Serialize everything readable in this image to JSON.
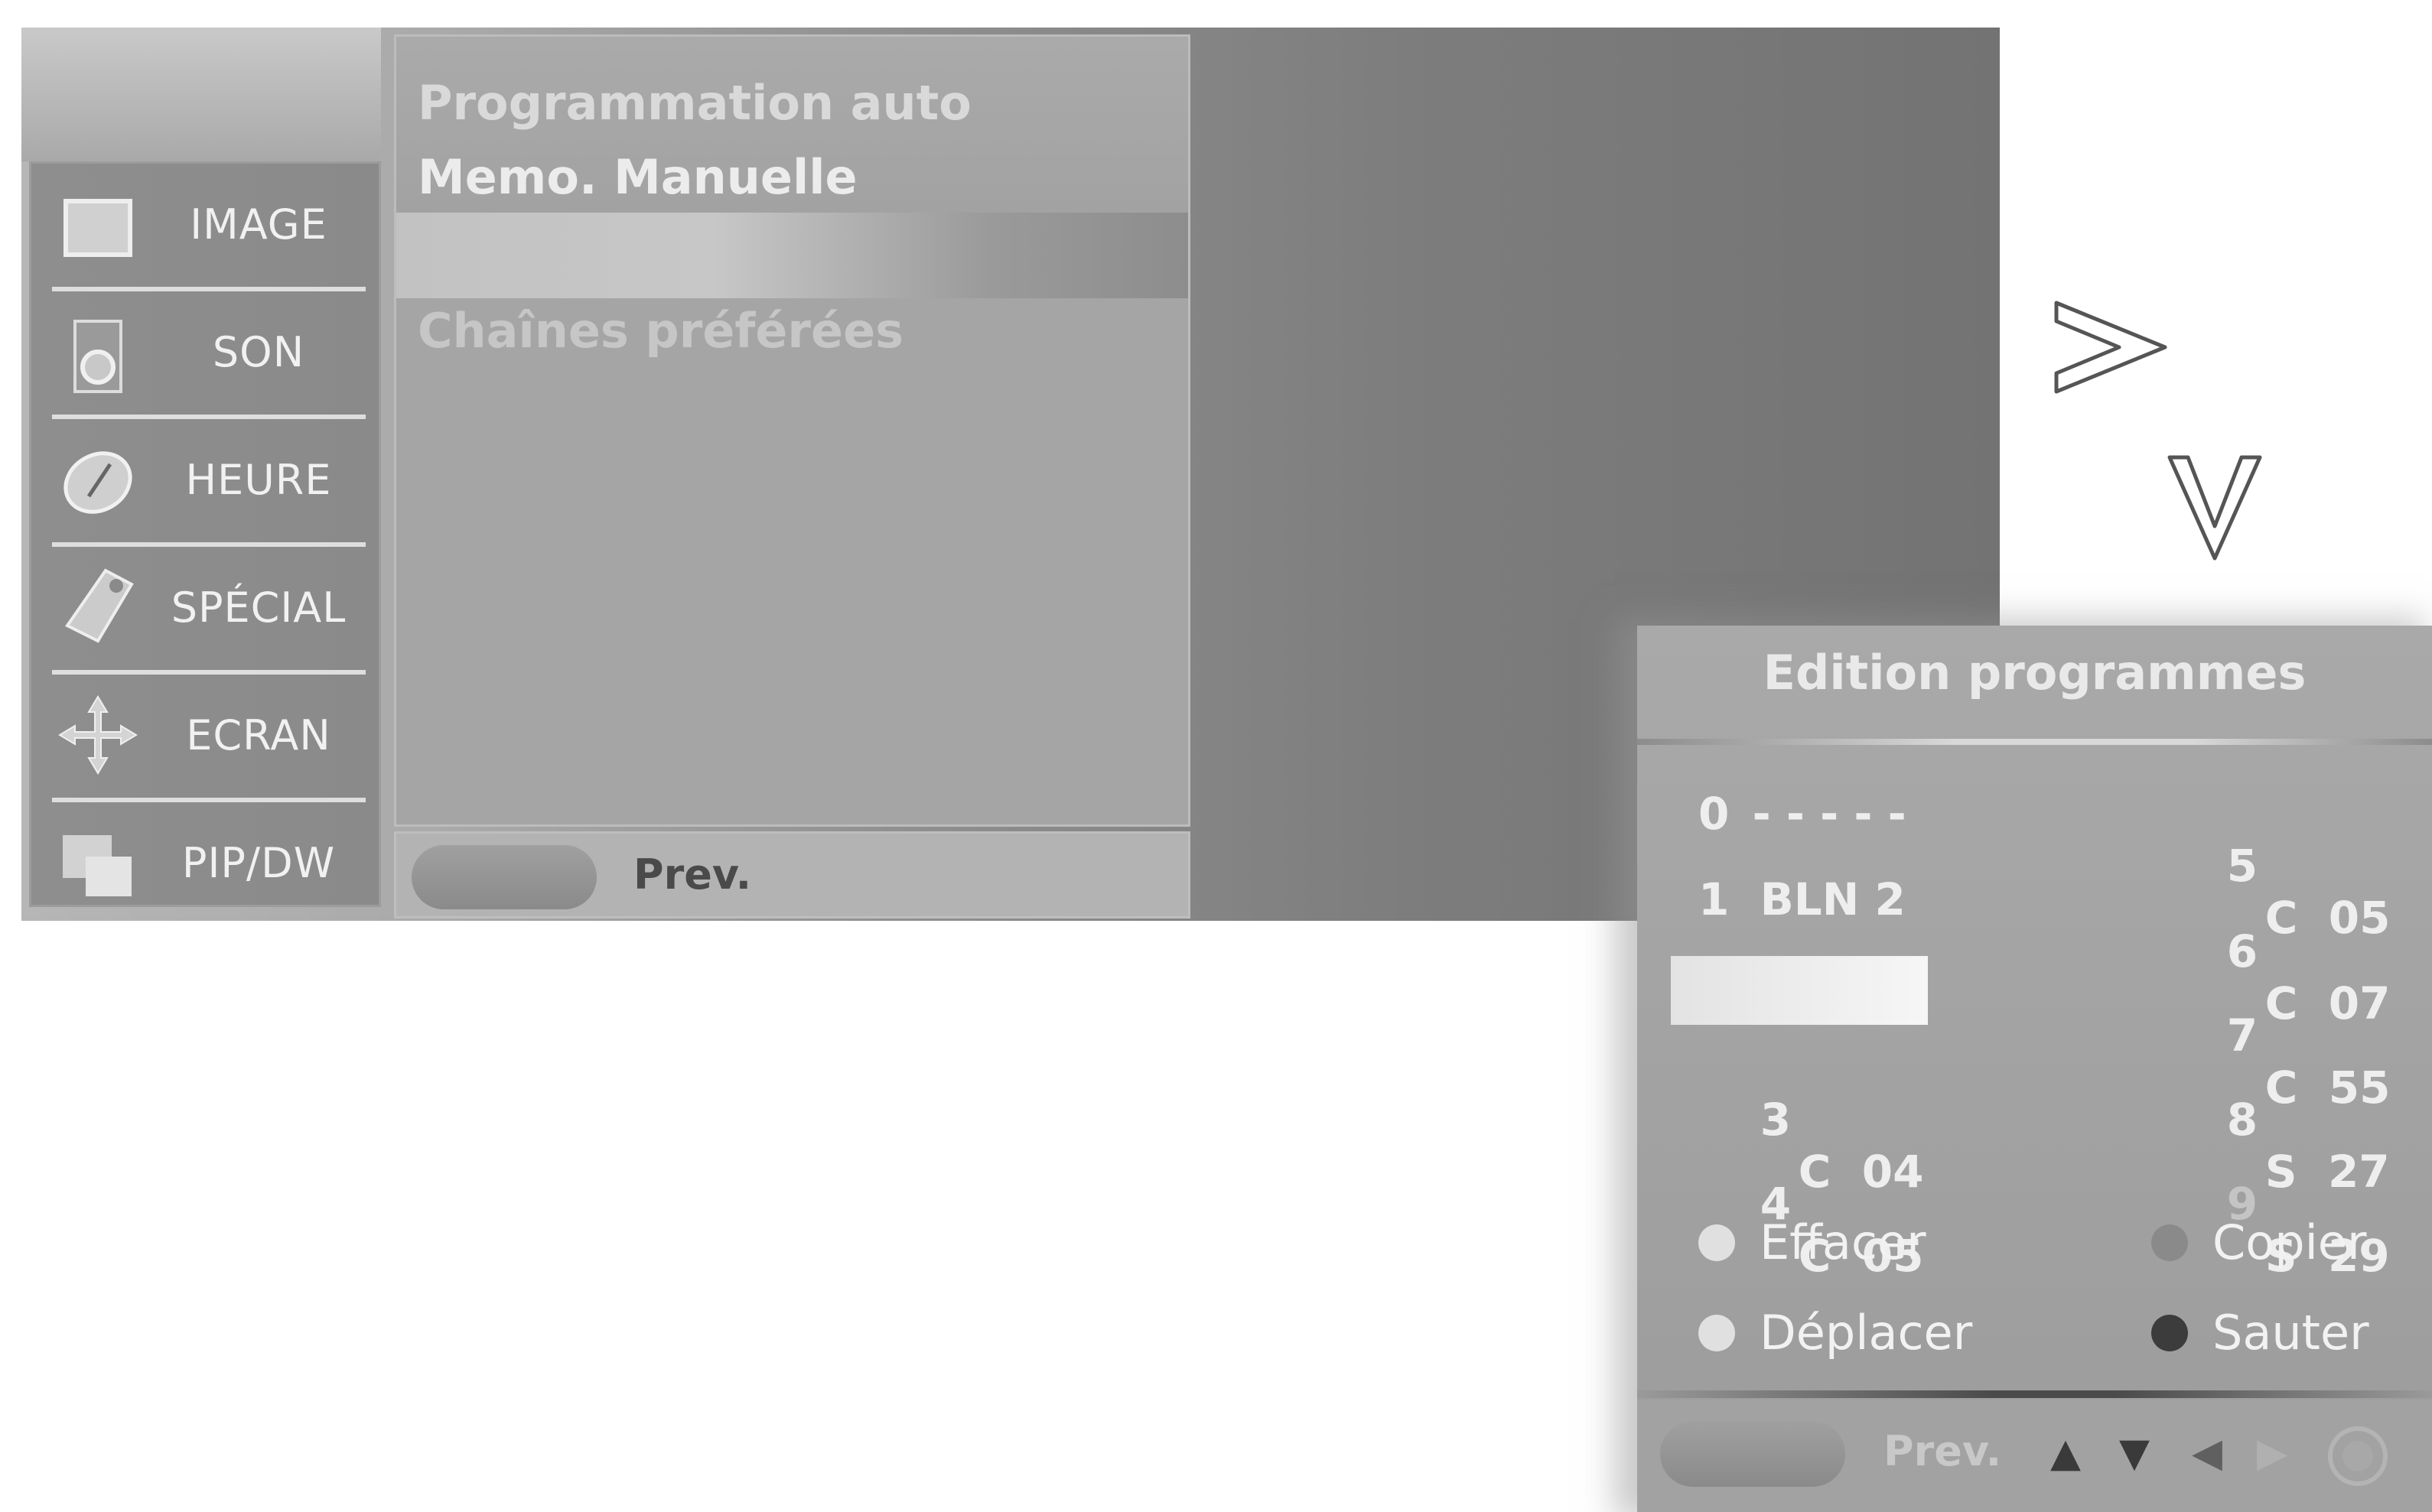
{
  "main_menu": {
    "sidebar": [
      {
        "label": "IMAGE",
        "icon": "picture-icon"
      },
      {
        "label": "SON",
        "icon": "speaker-icon"
      },
      {
        "label": "HEURE",
        "icon": "clock-icon"
      },
      {
        "label": "SPÉCIAL",
        "icon": "tag-icon"
      },
      {
        "label": "ECRAN",
        "icon": "move-cross-icon"
      },
      {
        "label": "PIP/DW",
        "icon": "pip-icon"
      }
    ],
    "submenu": {
      "items": [
        "Programmation auto",
        "Memo. Manuelle",
        "",
        "Chaînes préférées"
      ]
    },
    "bottom_bar": {
      "prev_label": "Prev."
    }
  },
  "nav_indicators": {
    "right": "⋗",
    "down": "⋁"
  },
  "edit_panel": {
    "title": "Edition programmes",
    "left_channels": [
      {
        "num": "0",
        "name": "- - - - -"
      },
      {
        "num": "1",
        "name": "BLN 2"
      },
      {
        "num": "",
        "name": ""
      },
      {
        "num": "3",
        "name": "C  04"
      },
      {
        "num": "4",
        "name": "C  05"
      }
    ],
    "right_channels": [
      {
        "num": "5",
        "name": "C  05"
      },
      {
        "num": "6",
        "name": "C  07"
      },
      {
        "num": "7",
        "name": "C  55"
      },
      {
        "num": "8",
        "name": "S  27"
      },
      {
        "num": "9",
        "name": "S  29"
      }
    ],
    "actions": {
      "delete": "Effacer",
      "copy": "Copier",
      "move": "Déplacer",
      "skip": "Sauter"
    },
    "bottom_bar": {
      "prev_label": "Prev.",
      "up": "▲",
      "down": "▼",
      "left": "◀",
      "right": "▶"
    }
  },
  "colors": {
    "accent_white": "#ffffff",
    "panel_gray": "#a5a5a5",
    "text_light": "#eeeeee"
  }
}
